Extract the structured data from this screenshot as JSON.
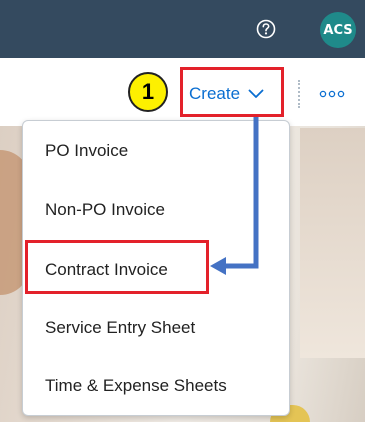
{
  "topbar": {
    "help_icon": "help-circle-icon",
    "avatar_initials": "ACS"
  },
  "toolbar": {
    "create_label": "Create",
    "create_icon": "chevron-down-icon",
    "more_icon": "overflow-icon"
  },
  "annotation": {
    "step_number": "1",
    "highlight_color": "#e3212a",
    "arrow_color": "#4472c4",
    "badge_color": "#fdf000"
  },
  "menu": {
    "items": [
      {
        "label": "PO Invoice"
      },
      {
        "label": "Non-PO Invoice"
      },
      {
        "label": "Contract Invoice"
      },
      {
        "label": "Service Entry Sheet"
      },
      {
        "label": "Time & Expense Sheets"
      }
    ]
  },
  "colors": {
    "shell_bar": "#344a5f",
    "accent": "#0a6ed1",
    "avatar": "#1f8a8a"
  }
}
